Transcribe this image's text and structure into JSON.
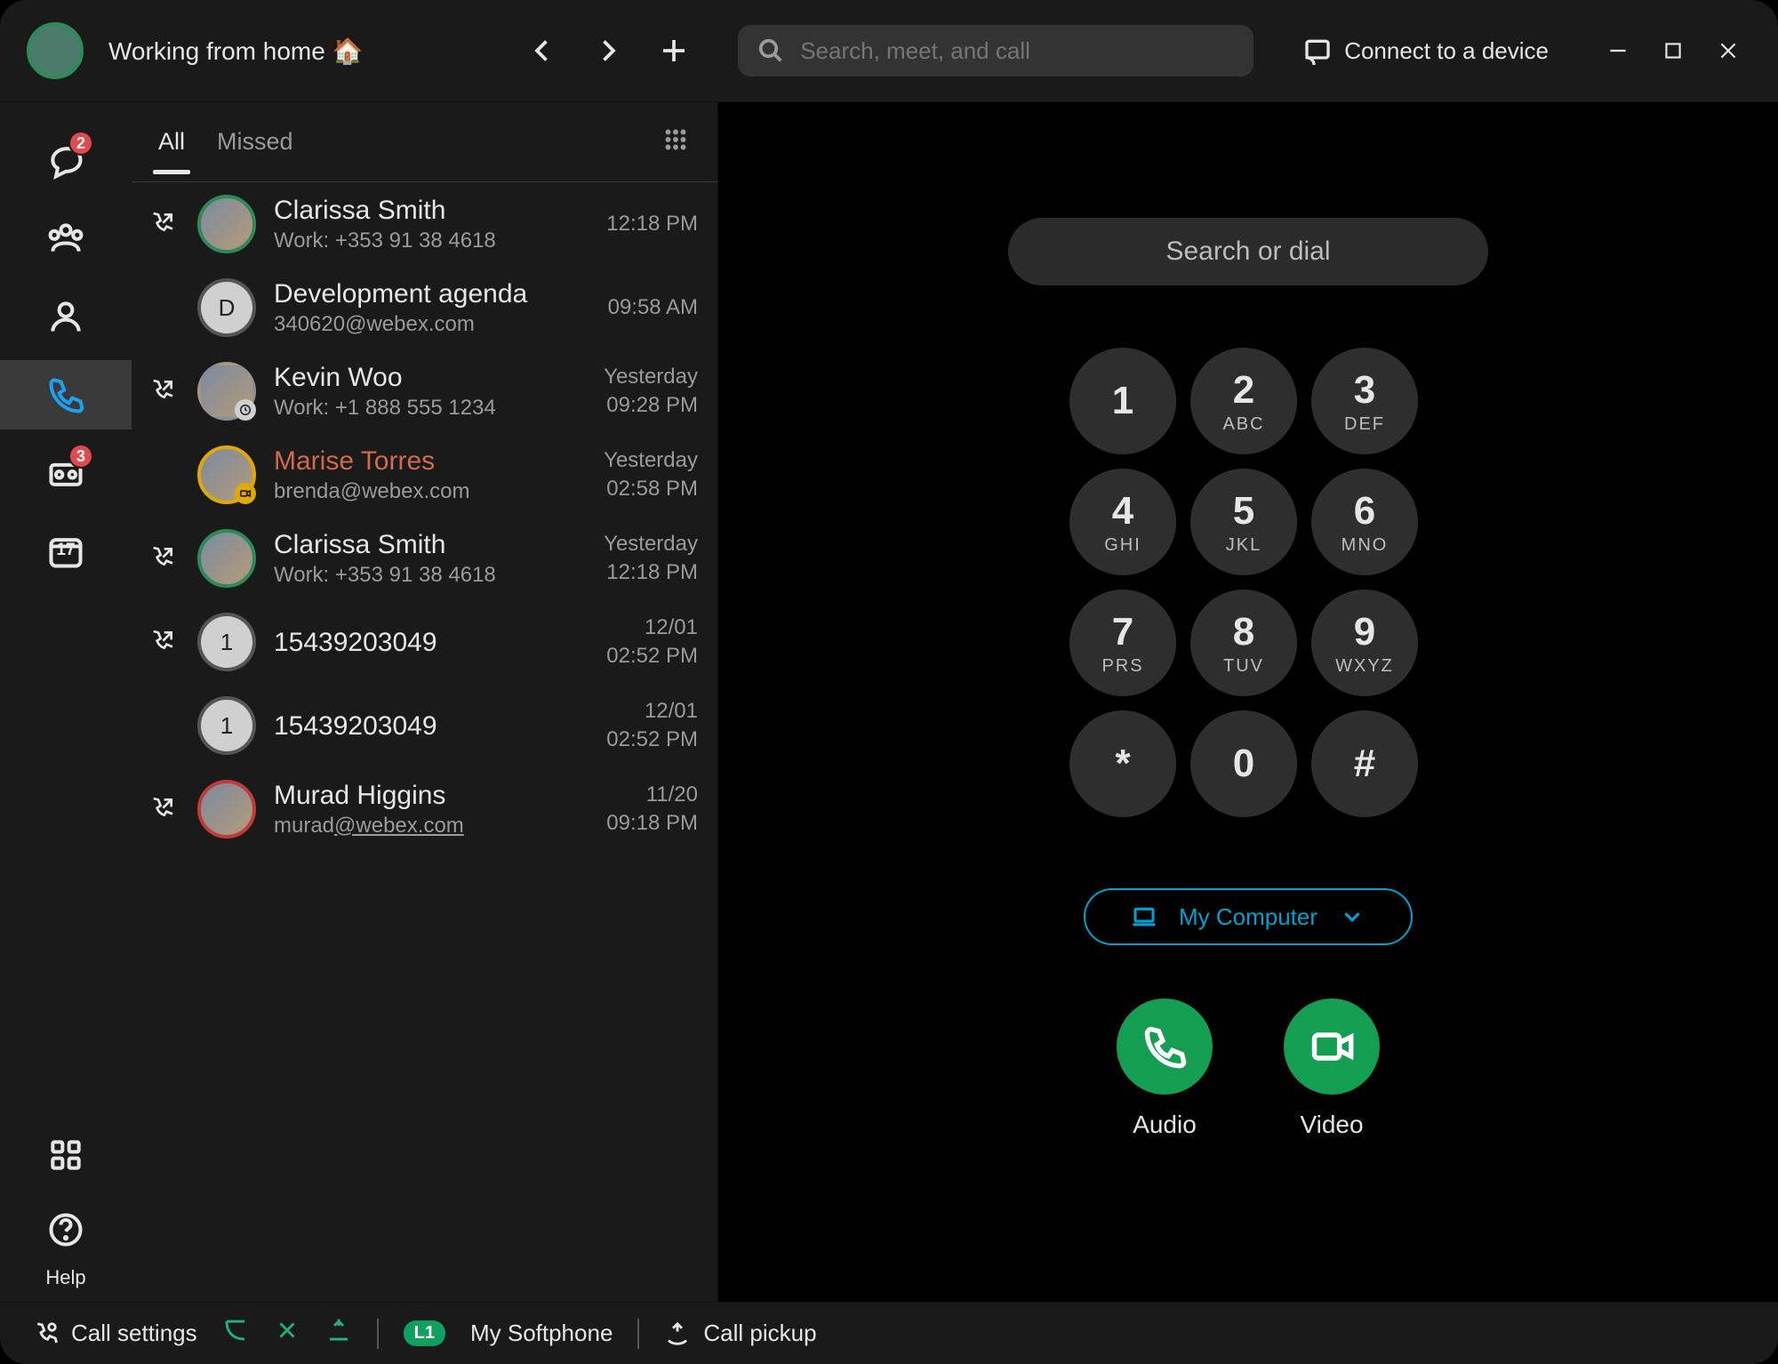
{
  "header": {
    "status": "Working from home 🏠",
    "search_placeholder": "Search, meet, and call",
    "connect_label": "Connect to a device"
  },
  "rail": {
    "chat_badge": "2",
    "voicemail_badge": "3",
    "calendar_day": "17",
    "help_label": "Help"
  },
  "tabs": {
    "all": "All",
    "missed": "Missed"
  },
  "calls": [
    {
      "name": "Clarissa Smith",
      "sub": "Work: +353 91 38 4618",
      "d1": "",
      "d2": "12:18 PM",
      "missed": false,
      "dir": "out",
      "avatar": "ring-green"
    },
    {
      "name": "Development agenda",
      "sub": "340620@webex.com",
      "d1": "",
      "d2": "09:58 AM",
      "missed": false,
      "dir": "",
      "avatar": "initial",
      "initial": "D"
    },
    {
      "name": "Kevin Woo",
      "sub": "Work: +1 888 555 1234",
      "d1": "Yesterday",
      "d2": "09:28 PM",
      "missed": false,
      "dir": "out",
      "avatar": "photo",
      "clock": true
    },
    {
      "name": "Marise Torres",
      "sub": "brenda@webex.com",
      "d1": "Yesterday",
      "d2": "02:58 PM",
      "missed": true,
      "dir": "",
      "avatar": "ring-yellow",
      "cam": true
    },
    {
      "name": "Clarissa Smith",
      "sub": "Work: +353 91 38 4618",
      "d1": "Yesterday",
      "d2": "12:18 PM",
      "missed": false,
      "dir": "out",
      "avatar": "ring-green"
    },
    {
      "name": "15439203049",
      "sub": "",
      "d1": "12/01",
      "d2": "02:52 PM",
      "missed": false,
      "dir": "out",
      "avatar": "initial",
      "initial": "1"
    },
    {
      "name": "15439203049",
      "sub": "",
      "d1": "12/01",
      "d2": "02:52 PM",
      "missed": false,
      "dir": "",
      "avatar": "initial",
      "initial": "1"
    },
    {
      "name": "Murad Higgins",
      "sub": "murad@webex.com",
      "d1": "11/20",
      "d2": "09:18 PM",
      "missed": false,
      "dir": "out",
      "avatar": "ring-red",
      "under": true
    }
  ],
  "dialer": {
    "search_placeholder": "Search or dial",
    "keys": [
      {
        "d": "1",
        "l": ""
      },
      {
        "d": "2",
        "l": "ABC"
      },
      {
        "d": "3",
        "l": "DEF"
      },
      {
        "d": "4",
        "l": "GHI"
      },
      {
        "d": "5",
        "l": "JKL"
      },
      {
        "d": "6",
        "l": "MNO"
      },
      {
        "d": "7",
        "l": "PRS"
      },
      {
        "d": "8",
        "l": "TUV"
      },
      {
        "d": "9",
        "l": "WXYZ"
      },
      {
        "d": "*",
        "l": ""
      },
      {
        "d": "0",
        "l": ""
      },
      {
        "d": "#",
        "l": ""
      }
    ],
    "device_label": "My Computer",
    "audio_label": "Audio",
    "video_label": "Video"
  },
  "footer": {
    "call_settings": "Call settings",
    "softphone_badge": "L1",
    "softphone_label": "My Softphone",
    "call_pickup": "Call pickup"
  }
}
